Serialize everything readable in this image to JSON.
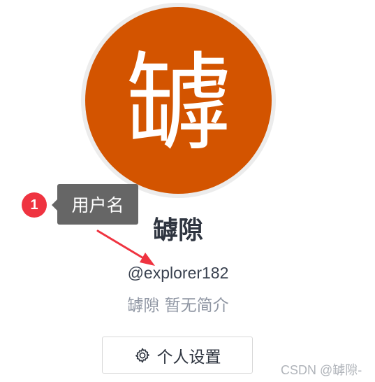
{
  "profile": {
    "avatar_text": "罅",
    "display_name": "罅隙",
    "username": "@explorer182",
    "bio": "罅隙 暂无简介"
  },
  "tour": {
    "step_number": "1",
    "tooltip_label": "用户名"
  },
  "actions": {
    "settings_label": "个人设置"
  },
  "watermark": {
    "text": "CSDN @罅隙-"
  },
  "colors": {
    "avatar_bg": "#d35400",
    "tour_badge": "#ef3340",
    "tooltip_bg": "#666666",
    "arrow": "#ef3340"
  },
  "icons": {
    "settings": "gear-icon"
  }
}
